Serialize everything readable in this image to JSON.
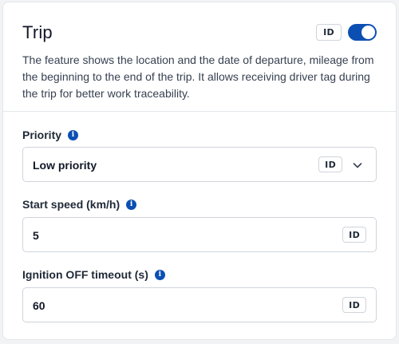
{
  "header": {
    "title": "Trip",
    "id_badge": "ID",
    "enabled": true,
    "description": "The feature shows the location and the date of departure, mileage from the beginning to the end of the trip. It allows receiving driver tag during the trip for better work traceability."
  },
  "fields": {
    "priority": {
      "label": "Priority",
      "value": "Low priority",
      "badge": "ID"
    },
    "start_speed": {
      "label": "Start speed (km/h)",
      "value": "5",
      "badge": "ID"
    },
    "ignition_timeout": {
      "label": "Ignition OFF timeout (s)",
      "value": "60",
      "badge": "ID"
    }
  },
  "icons": {
    "info": "info-icon",
    "chevron": "chevron-down-icon"
  },
  "colors": {
    "accent": "#0b4fb3",
    "border": "#cfd4da",
    "background": "#f2f3f5"
  }
}
